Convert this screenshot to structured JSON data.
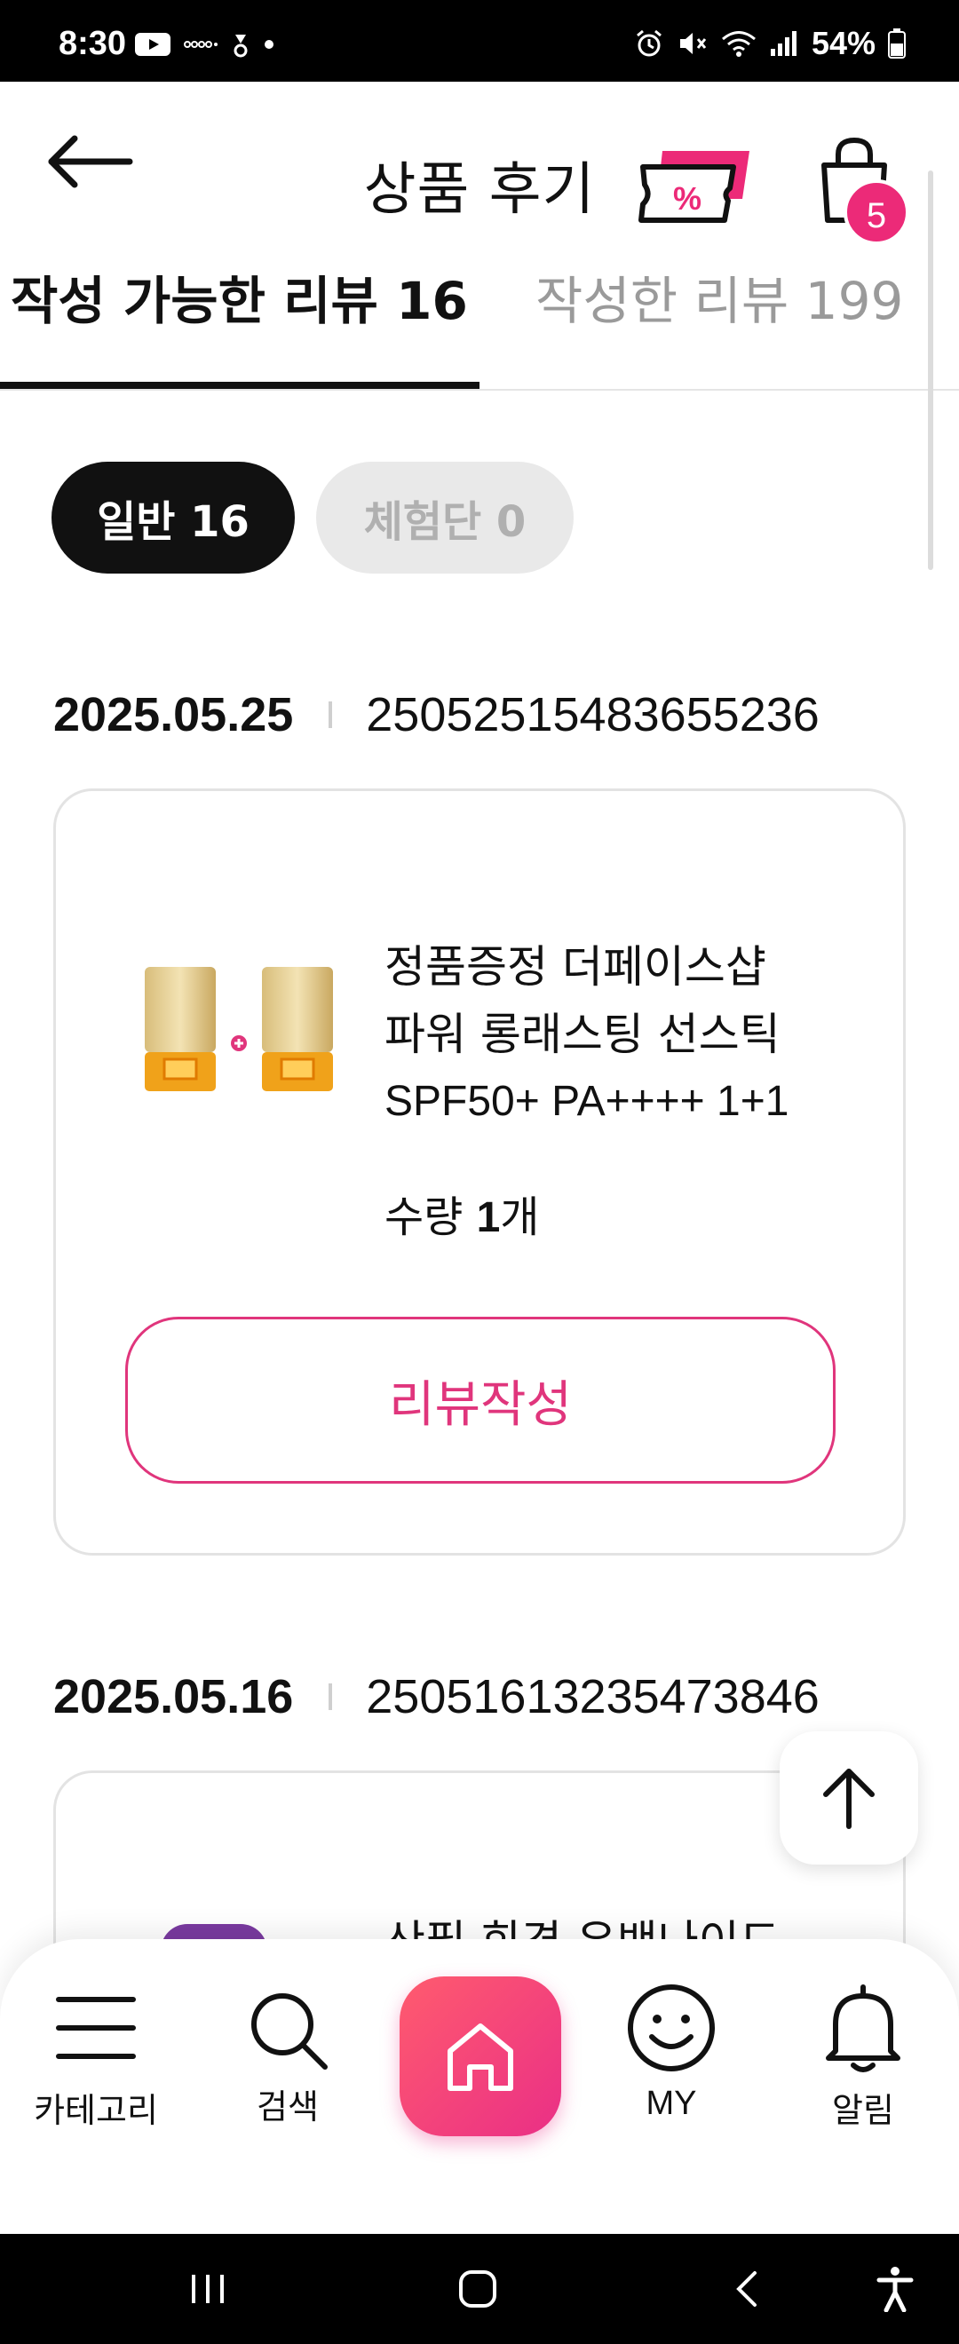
{
  "status_bar": {
    "time": "8:30",
    "battery": "54%",
    "left_icons": [
      "youtube-icon",
      "voicemail-icon",
      "notification-icon",
      "dot-icon"
    ],
    "right_icons": [
      "alarm-icon",
      "mute-icon",
      "wifi-icon",
      "signal-icon",
      "battery-icon"
    ]
  },
  "header": {
    "title": "상품 후기",
    "cart_count": "5",
    "icons": [
      "arrow-left-icon",
      "coupon-icon",
      "shopping-bag-icon"
    ],
    "accent_color": "#ec2a78"
  },
  "tabs": [
    {
      "label": "작성 가능한 리뷰 16",
      "active": true
    },
    {
      "label": "작성한 리뷰 199",
      "active": false
    }
  ],
  "filters": [
    {
      "label": "일반 16",
      "active": true
    },
    {
      "label": "체험단 0",
      "active": false
    }
  ],
  "orders": [
    {
      "date": "2025.05.25",
      "order_no": "25052515483655236",
      "product_name_line1": "정품증정 더페이스샵",
      "product_name_line2": "파워 롱래스팅 선스틱",
      "product_name_line3": "SPF50+ PA++++ 1+1",
      "qty_label": "수량",
      "qty_value": "1",
      "qty_unit": "개",
      "review_button": "리뷰작성"
    },
    {
      "date": "2025.05.16",
      "order_no": "25051613235473846",
      "product_name_partial": "산필 회경 유밴나이드"
    }
  ],
  "bottom_nav": [
    {
      "label": "카테고리",
      "icon": "menu-icon"
    },
    {
      "label": "검색",
      "icon": "search-icon"
    },
    {
      "label": "",
      "icon": "home-icon"
    },
    {
      "label": "MY",
      "icon": "smiley-icon"
    },
    {
      "label": "알림",
      "icon": "bell-icon"
    }
  ],
  "android_nav": [
    "recents-icon",
    "home-circle-icon",
    "back-chevron-icon",
    "accessibility-icon"
  ]
}
